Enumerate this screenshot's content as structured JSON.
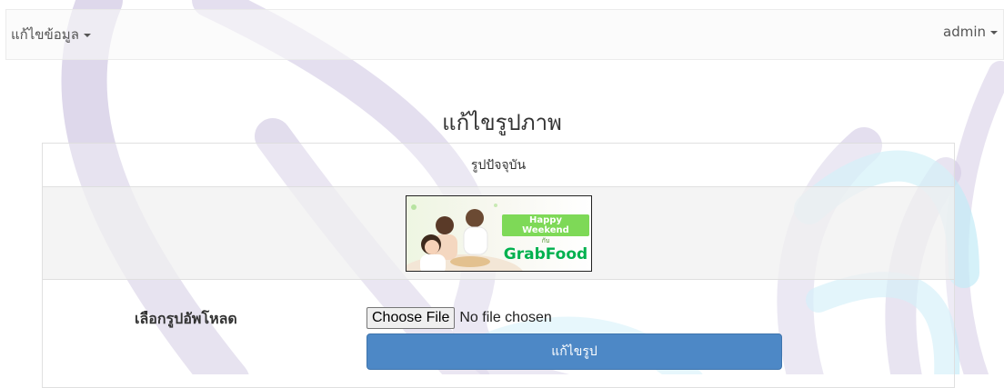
{
  "navbar": {
    "edit_menu_label": "แก้ไขข้อมูล",
    "user_menu_label": "admin"
  },
  "page": {
    "title": "แก้ไขรูปภาพ"
  },
  "panel": {
    "heading": "รูปปัจจุบัน",
    "current_image": {
      "banner_badge": "Happy Weekend",
      "banner_with": "กับ",
      "banner_brand": "GrabFood"
    }
  },
  "form": {
    "upload_label": "เลือกรูปอัพโหลด",
    "choose_file_label": "Choose File",
    "file_status": "No file chosen",
    "submit_label": "แก้ไขรูป"
  },
  "colors": {
    "primary_button": "#4d88c6",
    "watermark_purple": "#d6cfe6",
    "watermark_cyan": "#c5ecf7"
  }
}
